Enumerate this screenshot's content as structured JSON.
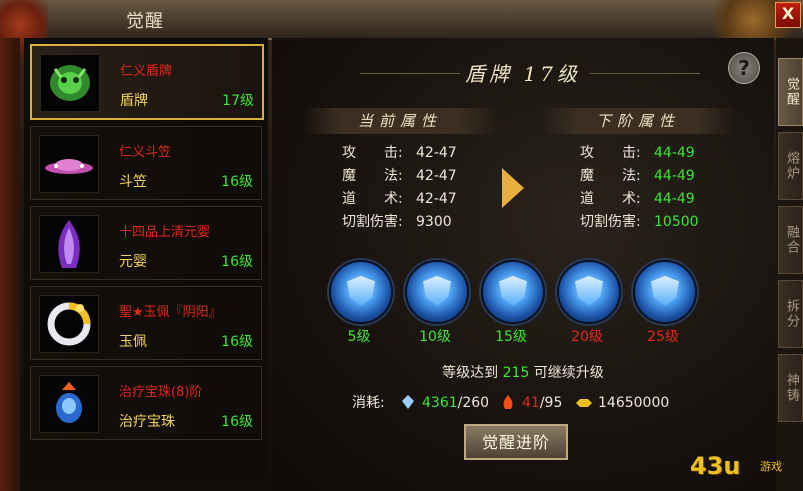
{
  "window": {
    "title": "觉醒",
    "close_label": "X"
  },
  "items": [
    {
      "name": "仁义盾牌",
      "type": "盾牌",
      "level": "17级",
      "selected": true,
      "icon": "green-demon-shield-icon"
    },
    {
      "name": "仁义斗笠",
      "type": "斗笠",
      "level": "16级",
      "selected": false,
      "icon": "pink-hat-icon"
    },
    {
      "name": "十四品上清元婴",
      "type": "元婴",
      "level": "16级",
      "selected": false,
      "icon": "purple-spirit-icon"
    },
    {
      "name": "聖★玉佩『阴阳』",
      "type": "玉佩",
      "level": "16级",
      "selected": false,
      "icon": "yin-yang-jade-icon"
    },
    {
      "name": "治疗宝珠(8)阶",
      "type": "治疗宝珠",
      "level": "16级",
      "selected": false,
      "icon": "blue-orb-icon"
    }
  ],
  "header": {
    "title": "盾牌 17级"
  },
  "current": {
    "title": "当前属性",
    "rows": [
      {
        "label": "攻　　击:",
        "value": "42-47"
      },
      {
        "label": "魔　　法:",
        "value": "42-47"
      },
      {
        "label": "道　　术:",
        "value": "42-47"
      },
      {
        "label": "切割伤害:",
        "value": "9300"
      }
    ]
  },
  "next": {
    "title": "下阶属性",
    "rows": [
      {
        "label": "攻　　击:",
        "value": "44-49"
      },
      {
        "label": "魔　　法:",
        "value": "44-49"
      },
      {
        "label": "道　　术:",
        "value": "44-49"
      },
      {
        "label": "切割伤害:",
        "value": "10500"
      }
    ]
  },
  "stages": [
    {
      "label": "5级",
      "reached": true
    },
    {
      "label": "10级",
      "reached": true
    },
    {
      "label": "15级",
      "reached": true
    },
    {
      "label": "20级",
      "reached": false
    },
    {
      "label": "25级",
      "reached": false
    }
  ],
  "requirement": {
    "prefix": "等级达到 ",
    "level": "215",
    "suffix": " 可继续升级"
  },
  "cost": {
    "label": "消耗:",
    "crystal_have": "4361",
    "crystal_need": "/260",
    "fire_have": "41",
    "fire_need": "/95",
    "gold": "14650000"
  },
  "action": {
    "label": "觉醒进阶"
  },
  "tabs": [
    "觉醒",
    "熔炉",
    "融合",
    "拆分",
    "神铸"
  ],
  "help_label": "?",
  "logo": {
    "text": "43u",
    "sub": "游戏"
  },
  "colors": {
    "highlight": "#d8b040",
    "green": "#3ce632",
    "red": "#e02818",
    "gold": "#f2d35a"
  }
}
